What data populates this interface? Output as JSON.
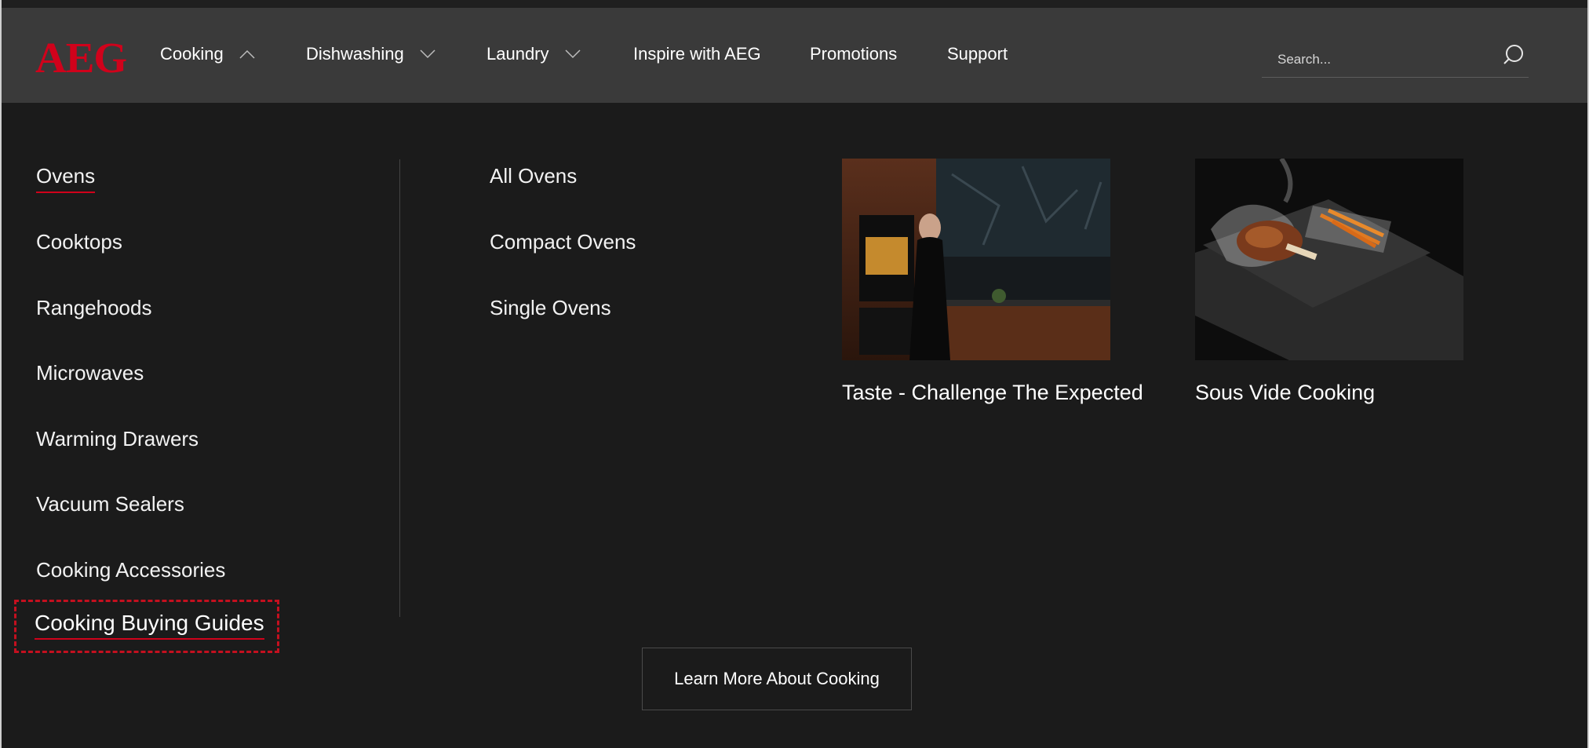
{
  "brand": {
    "logo_text": "AEG",
    "accent_color": "#d0021b"
  },
  "nav": {
    "items": [
      {
        "label": "Cooking",
        "icon": "chevron-up-icon"
      },
      {
        "label": "Dishwashing",
        "icon": "chevron-down-icon"
      },
      {
        "label": "Laundry",
        "icon": "chevron-down-icon"
      },
      {
        "label": "Inspire with AEG"
      },
      {
        "label": "Promotions"
      },
      {
        "label": "Support"
      }
    ]
  },
  "search": {
    "placeholder": "Search...",
    "icon": "search-icon"
  },
  "menu": {
    "categories": [
      {
        "label": "Ovens",
        "active": true
      },
      {
        "label": "Cooktops"
      },
      {
        "label": "Rangehoods"
      },
      {
        "label": "Microwaves"
      },
      {
        "label": "Warming Drawers"
      },
      {
        "label": "Vacuum Sealers"
      },
      {
        "label": "Cooking Accessories"
      },
      {
        "label": "Cooking Buying Guides"
      }
    ],
    "subitems": [
      {
        "label": "All Ovens"
      },
      {
        "label": "Compact Ovens"
      },
      {
        "label": "Single Ovens"
      }
    ],
    "cards": [
      {
        "caption": "Taste - Challenge The Expected",
        "image": "kitchen-woman-photo"
      },
      {
        "caption": "Sous Vide Cooking",
        "image": "sous-vide-steak-photo"
      }
    ],
    "cta_label": "Learn More About Cooking"
  }
}
